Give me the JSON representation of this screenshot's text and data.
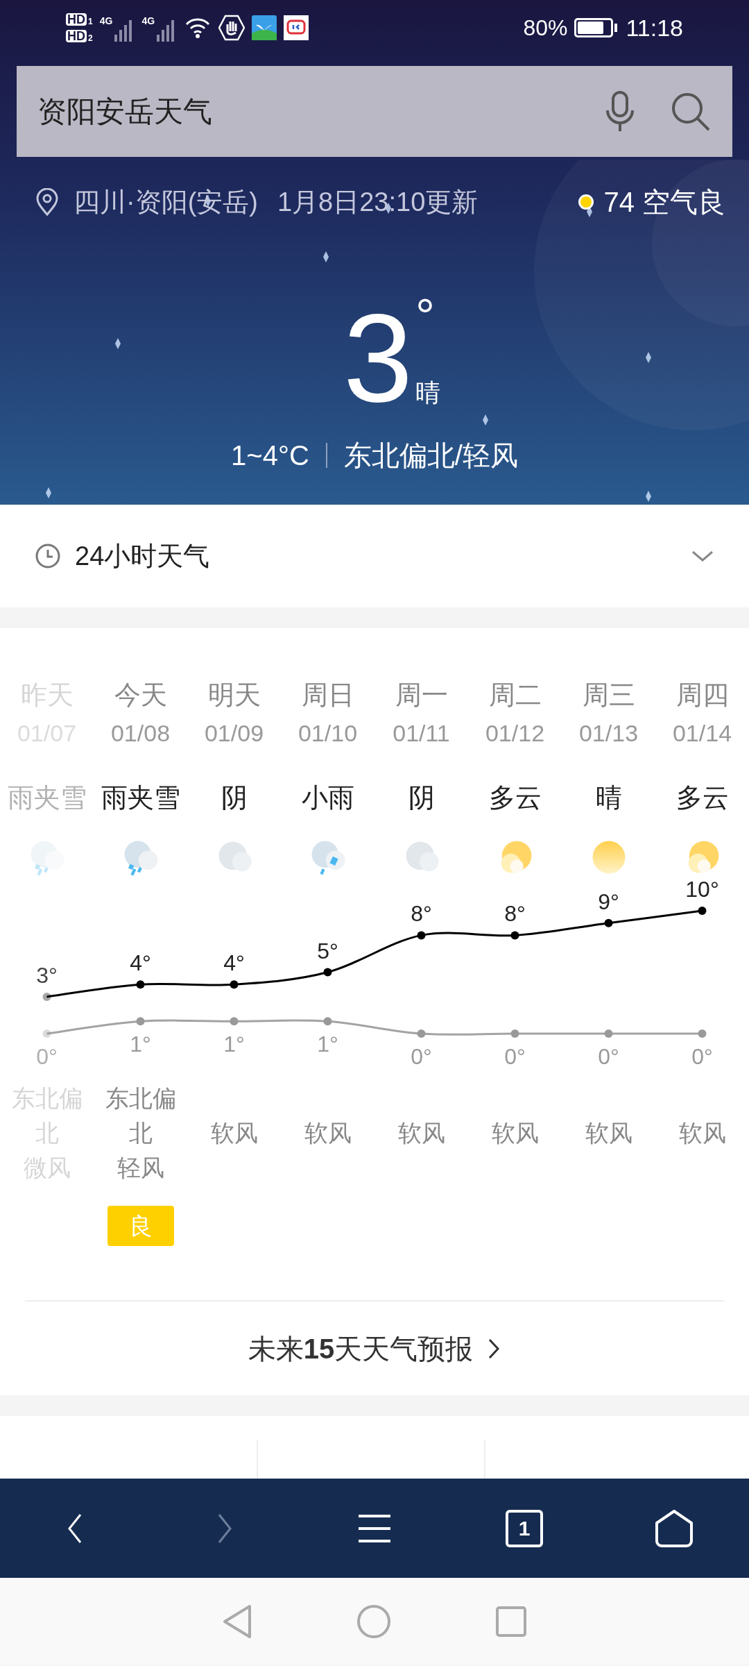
{
  "status_bar": {
    "sims": [
      {
        "label": "HD",
        "slot": "1"
      },
      {
        "label": "HD",
        "slot": "2"
      }
    ],
    "networks": [
      "4G",
      "4G"
    ],
    "battery": "80%",
    "time": "11:18"
  },
  "search": {
    "value": "资阳安岳天气"
  },
  "location": {
    "place": "四川·资阳(安岳)",
    "updated": "1月8日23:10更新",
    "aqi": "74 空气良"
  },
  "current": {
    "temp": "3",
    "degree": "°",
    "condition": "晴",
    "range": "1~4°C",
    "wind": "东北偏北/轻风"
  },
  "hourly": {
    "title": "24小时天气",
    "expanded": false
  },
  "days": [
    {
      "name": "昨天",
      "date": "01/07",
      "condition": "雨夹雪",
      "kind": "sleet",
      "wind_direction": "东北偏北",
      "wind_force": "微风",
      "past": true
    },
    {
      "name": "今天",
      "date": "01/08",
      "condition": "雨夹雪",
      "kind": "sleet",
      "wind_direction": "东北偏北",
      "wind_force": "轻风",
      "past": false,
      "aqi": "良"
    },
    {
      "name": "明天",
      "date": "01/09",
      "condition": "阴",
      "kind": "overcast",
      "wind_force": "软风",
      "past": false
    },
    {
      "name": "周日",
      "date": "01/10",
      "condition": "小雨",
      "kind": "rain",
      "wind_force": "软风",
      "past": false
    },
    {
      "name": "周一",
      "date": "01/11",
      "condition": "阴",
      "kind": "overcast",
      "wind_force": "软风",
      "past": false
    },
    {
      "name": "周二",
      "date": "01/12",
      "condition": "多云",
      "kind": "partly",
      "wind_force": "软风",
      "past": false
    },
    {
      "name": "周三",
      "date": "01/13",
      "condition": "晴",
      "kind": "sunny",
      "wind_force": "软风",
      "past": false
    },
    {
      "name": "周四",
      "date": "01/14",
      "condition": "多云",
      "kind": "partly",
      "wind_force": "软风",
      "past": false
    }
  ],
  "chart_data": {
    "type": "line",
    "series": [
      {
        "color": "#000000",
        "marker": true,
        "values": [
          3,
          4,
          4,
          5,
          8,
          8,
          9,
          10
        ],
        "value_labels": [
          "3°",
          "4°",
          "4°",
          "5°",
          "8°",
          "8°",
          "9°",
          "10°"
        ]
      },
      {
        "color": "#999999",
        "marker": true,
        "values": [
          0,
          1,
          1,
          1,
          0,
          0,
          0,
          0
        ],
        "value_labels": [
          "0°",
          "1°",
          "1°",
          "1°",
          "0°",
          "0°",
          "0°",
          "0°"
        ]
      }
    ]
  },
  "forecast_link": {
    "prefix": "未来",
    "count": "15",
    "suffix": "天天气预报"
  },
  "toolbar": {
    "forward_disabled": true,
    "tab_count": "1"
  }
}
